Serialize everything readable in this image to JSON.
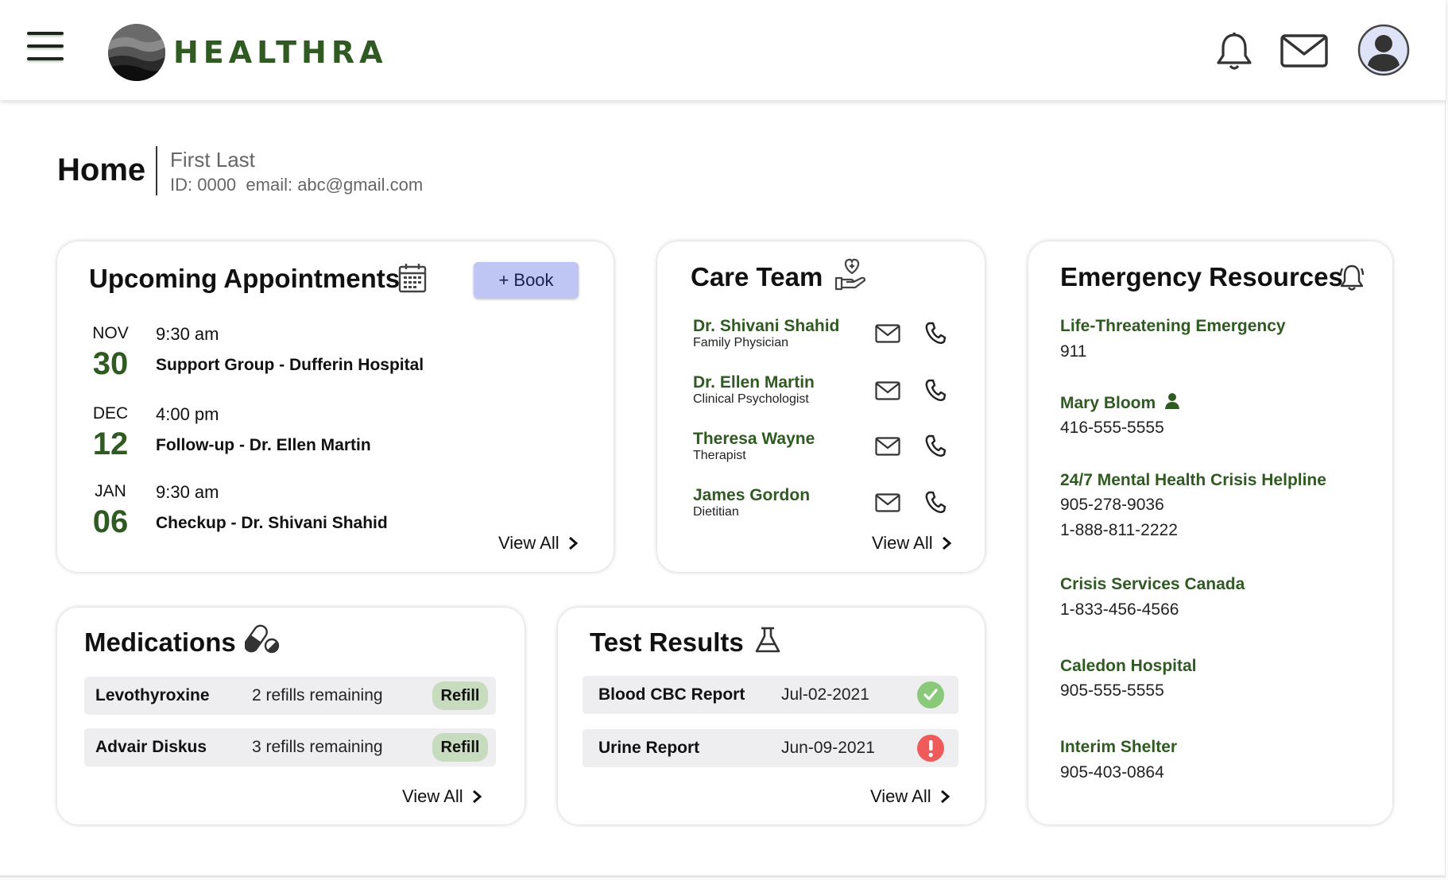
{
  "header": {
    "brand": "HEALTHRA",
    "icons": [
      "menu-icon",
      "bell-icon",
      "mail-icon",
      "user-avatar-icon"
    ]
  },
  "page": {
    "title": "Home",
    "user_name": "First Last",
    "user_meta": "ID: 0000  email: abc@gmail.com"
  },
  "appointments": {
    "title": "Upcoming Appointments",
    "book_label": "+ Book",
    "view_all": "View All",
    "items": [
      {
        "month": "NOV",
        "day": "30",
        "time": "9:30 am",
        "desc": "Support Group - Dufferin Hospital"
      },
      {
        "month": "DEC",
        "day": "12",
        "time": "4:00 pm",
        "desc": "Follow-up - Dr. Ellen Martin"
      },
      {
        "month": "JAN",
        "day": "06",
        "time": "9:30 am",
        "desc": "Checkup - Dr. Shivani Shahid"
      }
    ]
  },
  "care_team": {
    "title": "Care Team",
    "view_all": "View All",
    "members": [
      {
        "name": "Dr. Shivani Shahid",
        "role": "Family Physician"
      },
      {
        "name": "Dr. Ellen Martin",
        "role": "Clinical Psychologist"
      },
      {
        "name": "Theresa Wayne",
        "role": "Therapist"
      },
      {
        "name": "James Gordon",
        "role": "Dietitian"
      }
    ]
  },
  "emergency": {
    "title": "Emergency Resources",
    "items": [
      {
        "name": "Life-Threatening Emergency",
        "phones": [
          "911"
        ]
      },
      {
        "name": "Mary Bloom",
        "phones": [
          "416-555-5555"
        ]
      },
      {
        "name": "24/7 Mental Health Crisis Helpline",
        "phones": [
          "905-278-9036",
          "1-888-811-2222"
        ]
      },
      {
        "name": "Crisis Services Canada",
        "phones": [
          "1-833-456-4566"
        ]
      },
      {
        "name": "Caledon Hospital",
        "phones": [
          "905-555-5555"
        ]
      },
      {
        "name": "Interim Shelter",
        "phones": [
          "905-403-0864"
        ]
      }
    ]
  },
  "medications": {
    "title": "Medications",
    "view_all": "View All",
    "items": [
      {
        "name": "Levothyroxine",
        "refills": "2 refills remaining",
        "action": "Refill"
      },
      {
        "name": "Advair Diskus",
        "refills": "3 refills remaining",
        "action": "Refill"
      }
    ]
  },
  "tests": {
    "title": "Test Results",
    "view_all": "View All",
    "items": [
      {
        "name": "Blood CBC Report",
        "date": "Jul-02-2021",
        "status": "normal"
      },
      {
        "name": "Urine Report",
        "date": "Jun-09-2021",
        "status": "alert"
      }
    ]
  },
  "colors": {
    "brand_green": "#2f5a22",
    "book_button": "#bfc6f3",
    "refill": "#c7dcbf",
    "ok": "#8bc97a",
    "alert": "#ef5b5b"
  }
}
